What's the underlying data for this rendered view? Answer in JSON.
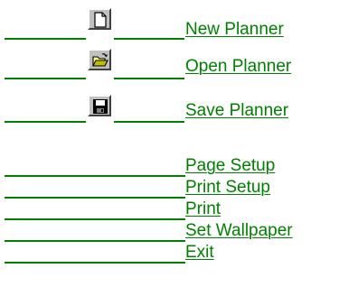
{
  "menu": {
    "items": [
      {
        "label": "New Planner",
        "icon": "new-document-icon"
      },
      {
        "label": "Open Planner",
        "icon": "open-folder-icon"
      },
      {
        "label": "Save Planner",
        "icon": "floppy-disk-icon"
      },
      {
        "label": "Page Setup"
      },
      {
        "label": "Print Setup"
      },
      {
        "label": "Print"
      },
      {
        "label": "Set Wallpaper"
      },
      {
        "label": "Exit"
      }
    ]
  },
  "colors": {
    "link": "#008000",
    "button_face": "#c0c0c0"
  }
}
